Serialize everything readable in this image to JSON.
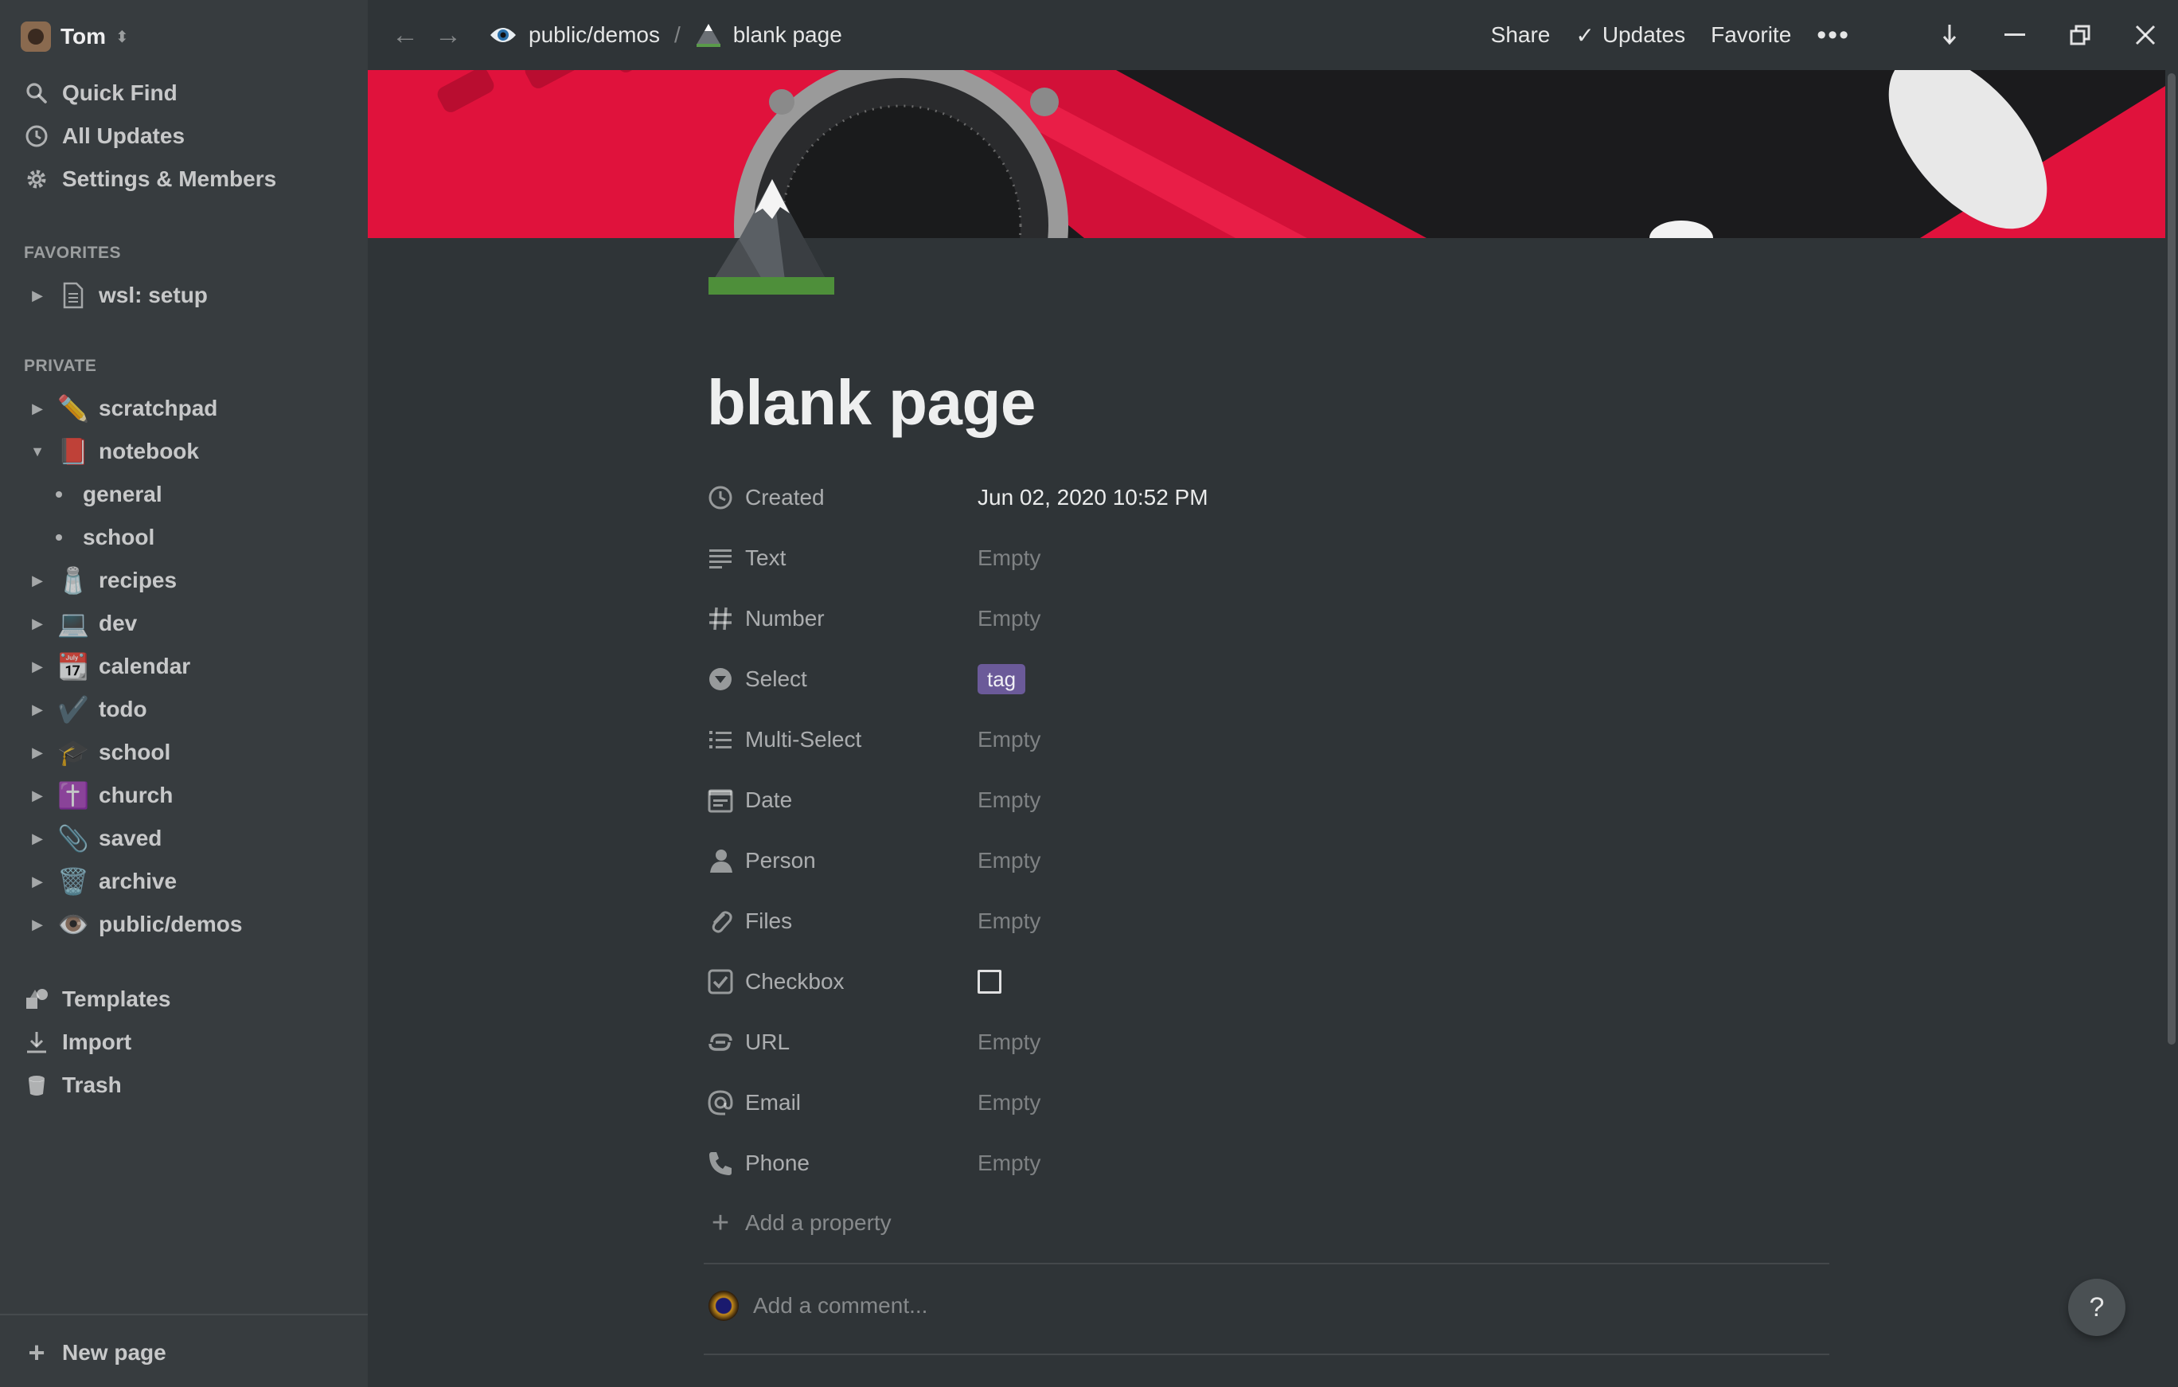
{
  "workspace": {
    "name": "Tom"
  },
  "sidebar": {
    "links": [
      {
        "label": "Quick Find",
        "icon": "search-icon"
      },
      {
        "label": "All Updates",
        "icon": "clock-icon"
      },
      {
        "label": "Settings & Members",
        "icon": "gear-icon"
      }
    ],
    "favorites_label": "FAVORITES",
    "favorites": [
      {
        "label": "wsl: setup",
        "icon": "page-icon"
      }
    ],
    "private_label": "PRIVATE",
    "private": [
      {
        "label": "scratchpad",
        "icon": "✏️",
        "expanded": false
      },
      {
        "label": "notebook",
        "icon": "📕",
        "expanded": true
      },
      {
        "label": "recipes",
        "icon": "🧂",
        "expanded": false
      },
      {
        "label": "dev",
        "icon": "💻",
        "expanded": false
      },
      {
        "label": "calendar",
        "icon": "📆",
        "expanded": false
      },
      {
        "label": "todo",
        "icon": "✔️",
        "expanded": false
      },
      {
        "label": "school",
        "icon": "🎓",
        "expanded": false
      },
      {
        "label": "church",
        "icon": "✝️",
        "expanded": false
      },
      {
        "label": "saved",
        "icon": "📎",
        "expanded": false
      },
      {
        "label": "archive",
        "icon": "🗑️",
        "expanded": false
      },
      {
        "label": "public/demos",
        "icon": "👁️",
        "expanded": false
      }
    ],
    "notebook_children": [
      "general",
      "school"
    ],
    "bottom_links": [
      {
        "label": "Templates",
        "icon": "templates-icon"
      },
      {
        "label": "Import",
        "icon": "import-icon"
      },
      {
        "label": "Trash",
        "icon": "trash-icon"
      }
    ],
    "new_page_label": "New page"
  },
  "topbar": {
    "breadcrumb": [
      "public/demos",
      "blank page"
    ],
    "separator": "/",
    "share_label": "Share",
    "updates_label": "Updates",
    "favorite_label": "Favorite",
    "more_label": "•••"
  },
  "page": {
    "title": "blank page",
    "properties": [
      {
        "name": "Created",
        "value": "Jun 02, 2020 10:52 PM",
        "icon": "clock-icon",
        "filled": true
      },
      {
        "name": "Text",
        "value": "Empty",
        "icon": "text-icon"
      },
      {
        "name": "Number",
        "value": "Empty",
        "icon": "hash-icon"
      },
      {
        "name": "Select",
        "value": "tag",
        "icon": "select-icon",
        "tag": true,
        "tag_color": "#6b5a99"
      },
      {
        "name": "Multi-Select",
        "value": "Empty",
        "icon": "list-icon"
      },
      {
        "name": "Date",
        "value": "Empty",
        "icon": "calendar-icon"
      },
      {
        "name": "Person",
        "value": "Empty",
        "icon": "person-icon"
      },
      {
        "name": "Files",
        "value": "Empty",
        "icon": "paperclip-icon"
      },
      {
        "name": "Checkbox",
        "value": "",
        "icon": "checkbox-icon",
        "checkbox": true
      },
      {
        "name": "URL",
        "value": "Empty",
        "icon": "link-icon"
      },
      {
        "name": "Email",
        "value": "Empty",
        "icon": "at-icon"
      },
      {
        "name": "Phone",
        "value": "Empty",
        "icon": "phone-icon"
      }
    ],
    "add_property_label": "Add a property",
    "comment_placeholder": "Add a comment..."
  },
  "help_label": "?",
  "colors": {
    "background": "#2f3437",
    "sidebar": "#373c3f",
    "tag": "#6b5a99"
  }
}
